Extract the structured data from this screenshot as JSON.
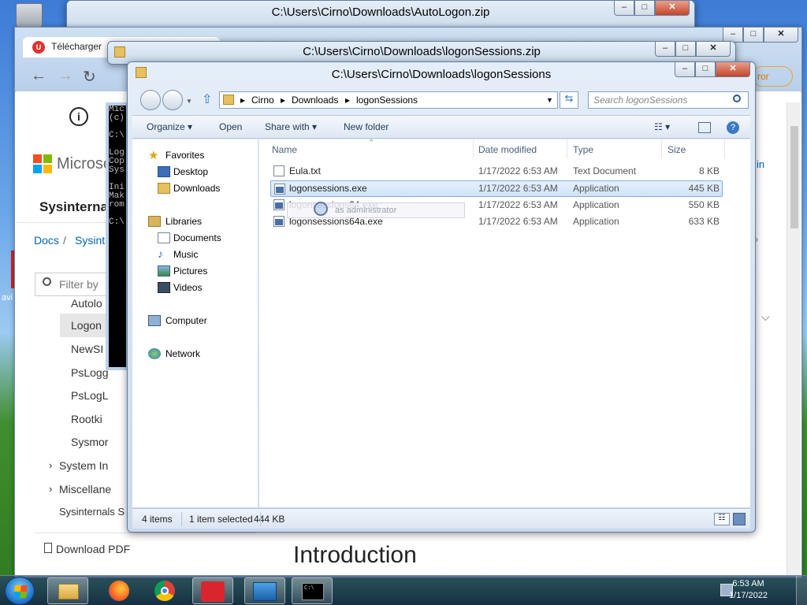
{
  "desktop": {
    "partial_label": "avi"
  },
  "browser": {
    "tab_label": "Télécharger",
    "tab_badge": "U",
    "info_letter": "i",
    "logo_text": "Microso",
    "sysinternals": "Sysinterna",
    "breadcrumb_docs": "Docs",
    "breadcrumb_sep": "/",
    "breadcrumb_sysint": "Sysint",
    "filter_placeholder": "Filter by",
    "sidebar": [
      "Autolo",
      "Logon",
      "NewSI",
      "PsLogg",
      "PsLogL",
      "Rootki",
      "Sysmor"
    ],
    "tree": [
      "System In",
      "Miscellane",
      "Sysinternals S"
    ],
    "download_pdf": "Download PDF",
    "heading": "Introduction",
    "right_edge_text": "in",
    "right_edge_orange": "ror"
  },
  "windows": {
    "autologon_zip_title": "C:\\Users\\Cirno\\Downloads\\AutoLogon.zip",
    "logonsessions_zip_title": "C:\\Users\\Cirno\\Downloads\\logonSessions.zip",
    "explorer_title": "C:\\Users\\Cirno\\Downloads\\logonSessions"
  },
  "cmd": {
    "lines": [
      "Mic",
      "(c)",
      "",
      "C:\\",
      "",
      "Log",
      "Cop",
      "Sys",
      "",
      "Ini",
      "Mak",
      "rom",
      "",
      "C:\\"
    ]
  },
  "explorer": {
    "breadcrumb": [
      "Cirno",
      "Downloads",
      "logonSessions"
    ],
    "search_placeholder": "Search logonSessions",
    "toolbar": {
      "organize": "Organize",
      "open": "Open",
      "share_with": "Share with",
      "new_folder": "New folder"
    },
    "nav": {
      "favorites": "Favorites",
      "desktop": "Desktop",
      "downloads": "Downloads",
      "libraries": "Libraries",
      "documents": "Documents",
      "music": "Music",
      "pictures": "Pictures",
      "videos": "Videos",
      "computer": "Computer",
      "network": "Network"
    },
    "columns": {
      "name": "Name",
      "date": "Date modified",
      "type": "Type",
      "size": "Size"
    },
    "files": [
      {
        "name": "Eula.txt",
        "date": "1/17/2022 6:53 AM",
        "type": "Text Document",
        "size": "8 KB",
        "icon": "text-file-icon"
      },
      {
        "name": "logonsessions.exe",
        "date": "1/17/2022 6:53 AM",
        "type": "Application",
        "size": "445 KB",
        "icon": "exe-file-icon"
      },
      {
        "name": "logonsessions64.exe",
        "date": "1/17/2022 6:53 AM",
        "type": "Application",
        "size": "550 KB",
        "icon": "exe-file-icon"
      },
      {
        "name": "logonsessions64a.exe",
        "date": "1/17/2022 6:53 AM",
        "type": "Application",
        "size": "633 KB",
        "icon": "exe-file-icon"
      }
    ],
    "tooltip": "as administrator",
    "status": {
      "items": "4 items",
      "selected": "1 item selected",
      "size": "444 KB"
    }
  },
  "taskbar": {
    "time": "6:53 AM",
    "date": "1/17/2022",
    "cmd_glyph": "C:\\",
    "apps": [
      "windows-explorer",
      "firefox",
      "chrome",
      "avira",
      "resource-monitor",
      "cmd"
    ]
  }
}
